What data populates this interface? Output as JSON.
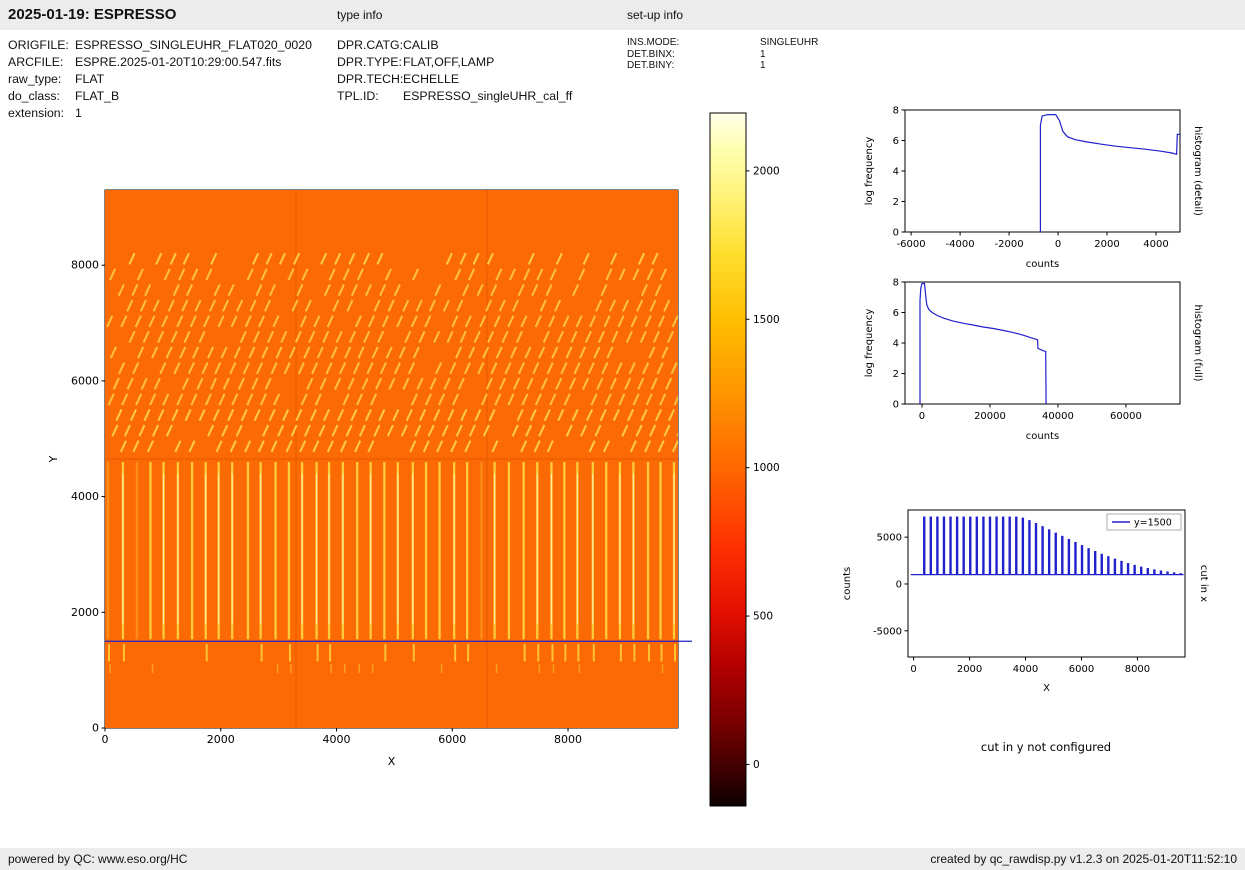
{
  "header": {
    "title": "2025-01-19: ESPRESSO",
    "type_info_label": "type info",
    "setup_info_label": "set-up info"
  },
  "file_info": {
    "rows": [
      {
        "label": "ORIGFILE:",
        "value": "ESPRESSO_SINGLEUHR_FLAT020_0020"
      },
      {
        "label": "ARCFILE:",
        "value": "ESPRE.2025-01-20T10:29:00.547.fits"
      },
      {
        "label": "raw_type:",
        "value": "FLAT"
      },
      {
        "label": "do_class:",
        "value": "FLAT_B"
      },
      {
        "label": "extension:",
        "value": "1"
      }
    ]
  },
  "type_info": {
    "rows": [
      {
        "label": "DPR.CATG:",
        "value": "CALIB"
      },
      {
        "label": "DPR.TYPE:",
        "value": "FLAT,OFF,LAMP"
      },
      {
        "label": "DPR.TECH:",
        "value": "ECHELLE"
      },
      {
        "label": "TPL.ID:",
        "value": "ESPRESSO_singleUHR_cal_ff"
      }
    ]
  },
  "setup_info": {
    "rows": [
      {
        "label": "INS.MODE:",
        "value": "SINGLEUHR"
      },
      {
        "label": "DET.BINX:",
        "value": "1"
      },
      {
        "label": "DET.BINY:",
        "value": "1"
      }
    ]
  },
  "notes": {
    "cut_in_y": "cut in y not configured"
  },
  "footer": {
    "left": "powered by QC: www.eso.org/HC",
    "right": "created by qc_rawdisp.py v1.2.3 on 2025-01-20T11:52:10"
  },
  "chart_data": [
    {
      "id": "raw_image",
      "type": "heatmap",
      "description": "ESPRESSO raw flat-field frame: bright echelle orders (solid vertical lines in lower half, slanted dashes in upper half) on orange background, horizontal blue cut line at y=1500",
      "xlabel": "X",
      "ylabel": "Y",
      "xlim": [
        0,
        9900
      ],
      "ylim": [
        0,
        9300
      ],
      "xticks": [
        0,
        2000,
        4000,
        6000,
        8000
      ],
      "yticks": [
        0,
        2000,
        4000,
        6000,
        8000
      ],
      "cut_line_y": 1500,
      "seam_y": 4650,
      "seams_x": [
        3300,
        6600
      ],
      "bands": {
        "solid_orders": [
          1500,
          4650
        ],
        "dashed_orders": [
          4700,
          8250
        ],
        "lower_dashes": [
          950,
          1500
        ]
      },
      "colors": {
        "base": "#fb6a04",
        "order": "#ffd23e",
        "order_core": "#fff6c0",
        "dash": "#ffcf45",
        "seam": "#e85c00",
        "cut": "#2020cc"
      }
    },
    {
      "id": "colorbar",
      "type": "colorbar",
      "ticks": [
        0,
        500,
        1000,
        1500,
        2000
      ],
      "range": [
        -140,
        2195
      ],
      "gradient": [
        [
          0,
          "#fffde8"
        ],
        [
          0.05,
          "#ffffb2"
        ],
        [
          0.12,
          "#fff378"
        ],
        [
          0.2,
          "#ffdf30"
        ],
        [
          0.3,
          "#ffbe00"
        ],
        [
          0.42,
          "#ff8e00"
        ],
        [
          0.52,
          "#ff6400"
        ],
        [
          0.62,
          "#ff3400"
        ],
        [
          0.72,
          "#e31000"
        ],
        [
          0.8,
          "#b20000"
        ],
        [
          0.88,
          "#790000"
        ],
        [
          0.95,
          "#3c0000"
        ],
        [
          1,
          "#0b0000"
        ]
      ]
    },
    {
      "id": "hist_detail",
      "type": "line",
      "right_label": "histogram (detail)",
      "xlabel": "counts",
      "ylabel": "log frequency",
      "color": "#2020cc",
      "xlim": [
        -6250,
        4980
      ],
      "ylim": [
        0,
        8
      ],
      "xticks": [
        -6000,
        -4000,
        -2000,
        0,
        2000,
        4000
      ],
      "yticks": [
        0,
        2,
        4,
        6,
        8
      ],
      "points": [
        [
          -720,
          0
        ],
        [
          -720,
          7.0
        ],
        [
          -650,
          7.6
        ],
        [
          -430,
          7.7
        ],
        [
          -90,
          7.7
        ],
        [
          60,
          7.3
        ],
        [
          200,
          6.6
        ],
        [
          380,
          6.25
        ],
        [
          700,
          6.05
        ],
        [
          1200,
          5.9
        ],
        [
          1800,
          5.75
        ],
        [
          2400,
          5.62
        ],
        [
          3000,
          5.52
        ],
        [
          3600,
          5.42
        ],
        [
          4200,
          5.3
        ],
        [
          4650,
          5.18
        ],
        [
          4840,
          5.1
        ],
        [
          4870,
          6.4
        ],
        [
          4975,
          6.4
        ]
      ]
    },
    {
      "id": "hist_full",
      "type": "line",
      "right_label": "histogram (full)",
      "xlabel": "counts",
      "ylabel": "log frequency",
      "color": "#2020cc",
      "xlim": [
        -5000,
        75900
      ],
      "ylim": [
        0,
        8
      ],
      "xticks": [
        0,
        20000,
        40000,
        60000
      ],
      "yticks": [
        0,
        2,
        4,
        6,
        8
      ],
      "points": [
        [
          -600,
          0
        ],
        [
          -600,
          6.8
        ],
        [
          -350,
          7.6
        ],
        [
          0,
          7.9
        ],
        [
          750,
          7.9
        ],
        [
          1100,
          7.1
        ],
        [
          1400,
          6.5
        ],
        [
          2000,
          6.2
        ],
        [
          3000,
          6.0
        ],
        [
          4500,
          5.8
        ],
        [
          6500,
          5.62
        ],
        [
          9000,
          5.45
        ],
        [
          12000,
          5.3
        ],
        [
          15000,
          5.18
        ],
        [
          18000,
          5.05
        ],
        [
          21000,
          4.95
        ],
        [
          24000,
          4.82
        ],
        [
          26500,
          4.7
        ],
        [
          28500,
          4.6
        ],
        [
          30000,
          4.5
        ],
        [
          32000,
          4.35
        ],
        [
          33500,
          4.25
        ],
        [
          34000,
          4.2
        ],
        [
          34100,
          3.65
        ],
        [
          35500,
          3.5
        ],
        [
          36400,
          3.45
        ],
        [
          36500,
          0
        ]
      ]
    },
    {
      "id": "cut_in_x",
      "type": "comb",
      "right_label": "cut in x",
      "legend": "y=1500",
      "xlabel": "X",
      "ylabel": "counts",
      "color": "#2020cc",
      "xlim": [
        -200,
        9700
      ],
      "ylim": [
        -7800,
        7900
      ],
      "xticks": [
        0,
        2000,
        4000,
        6000,
        8000
      ],
      "yticks": [
        -5000,
        0,
        5000
      ],
      "baseline": 1000,
      "baseline_x": [
        -100,
        9650
      ],
      "spike_start": 380,
      "spike_end": 9560,
      "spike_spacing": 235,
      "envelope": [
        [
          380,
          7200
        ],
        [
          3800,
          7200
        ],
        [
          4200,
          6750
        ],
        [
          4700,
          6050
        ],
        [
          5200,
          5300
        ],
        [
          5700,
          4600
        ],
        [
          6200,
          3900
        ],
        [
          6700,
          3250
        ],
        [
          7200,
          2700
        ],
        [
          7700,
          2200
        ],
        [
          8200,
          1800
        ],
        [
          8700,
          1500
        ],
        [
          9200,
          1280
        ],
        [
          9650,
          1120
        ]
      ]
    }
  ]
}
